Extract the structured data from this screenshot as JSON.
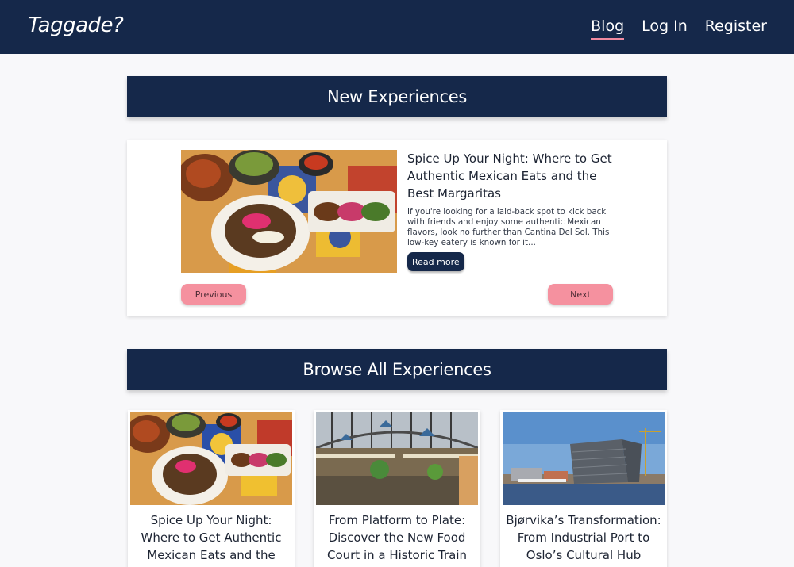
{
  "header": {
    "brand": "Taggade?",
    "nav": [
      "Blog",
      "Log In",
      "Register"
    ]
  },
  "sections": {
    "new_title": "New Experiences",
    "browse_title": "Browse All Experiences"
  },
  "featured": {
    "title": "Spice Up Your Night: Where to Get Authentic Mexican Eats and the Best Margaritas",
    "excerpt": "If you're looking for a laid-back spot to kick back with friends and enjoy some authentic Mexican flavors, look no further than Cantina Del Sol. This low-key eatery is known for it...",
    "read_more": "Read more",
    "previous": "Previous",
    "next": "Next"
  },
  "cards": [
    {
      "title": "Spice Up Your Night: Where to Get Authentic Mexican Eats and the Best Margaritas",
      "image": "mexican-food-photo"
    },
    {
      "title": "From Platform to Plate: Discover the New Food Court in a Historic Train Station",
      "image": "food-hall-photo"
    },
    {
      "title": "Bjørvika’s Transformation: From Industrial Port to Oslo’s Cultural Hub",
      "image": "oslo-harbour-photo"
    }
  ],
  "colors": {
    "navy": "#15284a",
    "pink": "#f5919f",
    "background": "#f8f8fa"
  }
}
